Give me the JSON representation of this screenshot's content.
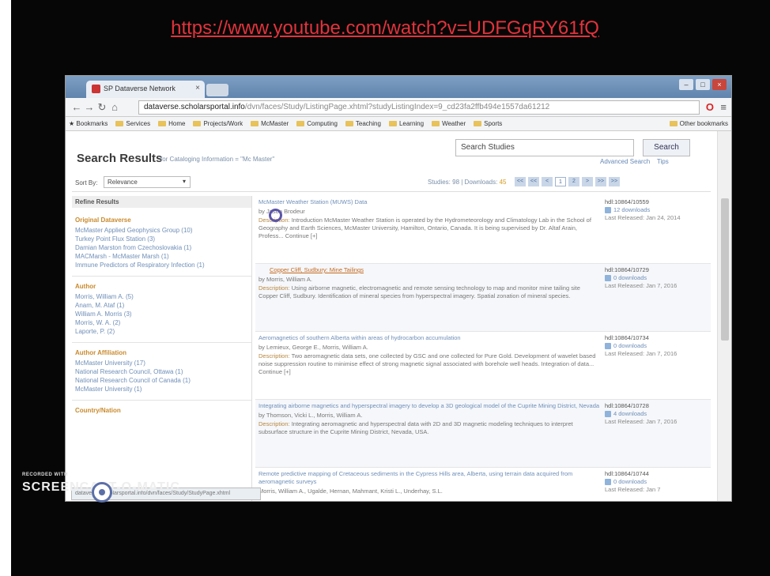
{
  "video_url": "https://www.youtube.com/watch?v=UDFGqRY61fQ",
  "browser": {
    "tab_title": "SP Dataverse Network",
    "url_host": "dataverse.scholarsportal.info",
    "url_rest": "/dvn/faces/Study/ListingPage.xhtml?studyListingIndex=9_cd23fa2ffb494e1557da61212",
    "bookmarks": [
      "Bookmarks",
      "Services",
      "Home",
      "Projects/Work",
      "McMaster",
      "Computing",
      "Teaching",
      "Learning",
      "Weather",
      "Sports"
    ],
    "other_bookmarks": "Other bookmarks"
  },
  "page": {
    "search_placeholder": "Search Studies",
    "search_button": "Search",
    "advanced_search": "Advanced Search",
    "tips": "Tips",
    "results_title": "Search Results",
    "results_subtitle": "for Cataloging Information = \"Mc Master\"",
    "sort_label": "Sort By:",
    "sort_value": "Relevance",
    "stats_text": "Studies: 98 | Downloads:",
    "downloads": "45",
    "pager": [
      "<<",
      "<<",
      "<",
      "1",
      "2",
      ">",
      ">>",
      ">>"
    ]
  },
  "sidebar": {
    "refine": "Refine Results",
    "facets": [
      {
        "title": "Original Dataverse",
        "items": [
          "McMaster Applied Geophysics Group (10)",
          "Turkey Point Flux Station (3)",
          "Damian Marston from Czechoslovakia (1)",
          "MACMarsh - McMaster Marsh (1)",
          "Immune Predictors of Respiratory Infection (1)"
        ]
      },
      {
        "title": "Author",
        "items": [
          "Morris, William A. (5)",
          "Anam, M. Ataf (1)",
          "William A. Morris (3)",
          "Morris, W. A. (2)",
          "Laporte, P. (2)"
        ]
      },
      {
        "title": "Author Affiliation",
        "items": [
          "McMaster University (17)",
          "National Research Council, Ottawa (1)",
          "National Research Council of Canada (1)",
          "McMaster University (1)"
        ]
      },
      {
        "title": "Country/Nation",
        "items": []
      }
    ]
  },
  "results": [
    {
      "title": "McMaster Weather Station (MUWS) Data",
      "author": "by Jason Brodeur",
      "desc_label": "Description:",
      "desc": "Introduction McMaster Weather Station is operated by the Hydrometeorology and Climatology Lab in the School of Geography and Earth Sciences, McMaster University, Hamilton, Ontario, Canada. It is being supervised by Dr. Altaf Arain, Profess... Continue [+]",
      "handle": "hdl:10864/10559",
      "downloads": "12 downloads",
      "released": "Last Released: Jan 24, 2014"
    },
    {
      "title": "Copper Cliff, Sudbury: Mine Tailings",
      "author": "by Morris, William A.",
      "desc_label": "Description:",
      "desc": "Using airborne magnetic, electromagnetic and remote sensing technology to map and monitor mine tailing site Copper Cliff, Sudbury. Identification of mineral species from hyperspectral imagery. Spatial zonation of mineral species.",
      "handle": "hdl:10864/10729",
      "downloads": "0 downloads",
      "released": "Last Released: Jan 7, 2016"
    },
    {
      "title": "Aeromagnetics of southern Alberta within areas of hydrocarbon accumulation",
      "author": "by Lemieux, George E., Morris, William A.",
      "desc_label": "Description:",
      "desc": "Two aeromagnetic data sets, one collected by GSC and one collected for Pure Gold. Development of wavelet based noise suppression routine to minimise effect of strong magnetic signal associated with borehole well heads. Integration of data... Continue [+]",
      "handle": "hdl:10864/10734",
      "downloads": "0 downloads",
      "released": "Last Released: Jan 7, 2016"
    },
    {
      "title": "Integrating airborne magnetics and hyperspectral imagery to develop a 3D geological model of the Cuprite Mining District, Nevada",
      "author": "by Thomson, Vicki L., Morris, William A.",
      "desc_label": "Description:",
      "desc": "Integrating aeromagnetic and hyperspectral data with 2D and 3D magnetic modeling techniques to interpret subsurface structure in the Cuprite Mining District, Nevada, USA.",
      "handle": "hdl:10864/10728",
      "downloads": "4 downloads",
      "released": "Last Released: Jan 7, 2016"
    },
    {
      "title": "Remote predictive mapping of Cretaceous sediments in the Cypress Hills area, Alberta, using terrain data acquired from aeromagnetic surveys",
      "author": "Morris, William A., Ugalde, Hernan, Mahmant, Kristi L., Underhay, S.L.",
      "desc_label": "",
      "desc": "",
      "handle": "hdl:10864/10744",
      "downloads": "0 downloads",
      "released": "Last Released: Jan 7"
    }
  ],
  "watermark": {
    "small": "RECORDED WITH",
    "big": "SCREENCAST-O-MATIC"
  },
  "status_url": "dataverse.scholarsportal.info/dvn/faces/Study/StudyPage.xhtml"
}
